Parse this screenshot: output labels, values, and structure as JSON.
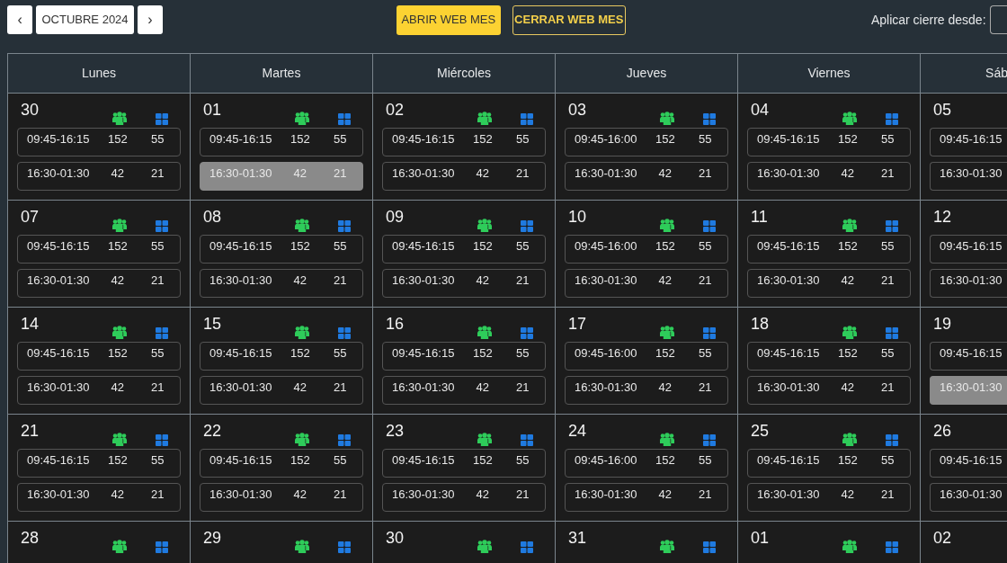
{
  "toolbar": {
    "prev": "‹",
    "month": "OCTUBRE 2024",
    "next": "›",
    "open_button": "ABRIR WEB MES",
    "close_button": "CERRAR WEB MES",
    "apply_label": "Aplicar cierre desde:"
  },
  "weekdays": [
    "Lunes",
    "Martes",
    "Miércoles",
    "Jueves",
    "Viernes",
    "Sáb"
  ],
  "weeks": [
    {
      "days": [
        {
          "day": "30",
          "slots": [
            {
              "time": "09:45-16:15",
              "col_a": "152",
              "col_b": "55",
              "selected": false
            },
            {
              "time": "16:30-01:30",
              "col_a": "42",
              "col_b": "21",
              "selected": false
            }
          ]
        },
        {
          "day": "01",
          "slots": [
            {
              "time": "09:45-16:15",
              "col_a": "152",
              "col_b": "55",
              "selected": false
            },
            {
              "time": "16:30-01:30",
              "col_a": "42",
              "col_b": "21",
              "selected": true
            }
          ]
        },
        {
          "day": "02",
          "slots": [
            {
              "time": "09:45-16:15",
              "col_a": "152",
              "col_b": "55",
              "selected": false
            },
            {
              "time": "16:30-01:30",
              "col_a": "42",
              "col_b": "21",
              "selected": false
            }
          ]
        },
        {
          "day": "03",
          "slots": [
            {
              "time": "09:45-16:00",
              "col_a": "152",
              "col_b": "55",
              "selected": false
            },
            {
              "time": "16:30-01:30",
              "col_a": "42",
              "col_b": "21",
              "selected": false
            }
          ]
        },
        {
          "day": "04",
          "slots": [
            {
              "time": "09:45-16:15",
              "col_a": "152",
              "col_b": "55",
              "selected": false
            },
            {
              "time": "16:30-01:30",
              "col_a": "42",
              "col_b": "21",
              "selected": false
            }
          ]
        },
        {
          "day": "05",
          "slots": [
            {
              "time": "09:45-16:15",
              "selected": false
            },
            {
              "time": "16:30-01:30",
              "selected": false
            }
          ]
        }
      ]
    },
    {
      "days": [
        {
          "day": "07",
          "slots": [
            {
              "time": "09:45-16:15",
              "col_a": "152",
              "col_b": "55",
              "selected": false
            },
            {
              "time": "16:30-01:30",
              "col_a": "42",
              "col_b": "21",
              "selected": false
            }
          ]
        },
        {
          "day": "08",
          "slots": [
            {
              "time": "09:45-16:15",
              "col_a": "152",
              "col_b": "55",
              "selected": false
            },
            {
              "time": "16:30-01:30",
              "col_a": "42",
              "col_b": "21",
              "selected": false
            }
          ]
        },
        {
          "day": "09",
          "slots": [
            {
              "time": "09:45-16:15",
              "col_a": "152",
              "col_b": "55",
              "selected": false
            },
            {
              "time": "16:30-01:30",
              "col_a": "42",
              "col_b": "21",
              "selected": false
            }
          ]
        },
        {
          "day": "10",
          "slots": [
            {
              "time": "09:45-16:00",
              "col_a": "152",
              "col_b": "55",
              "selected": false
            },
            {
              "time": "16:30-01:30",
              "col_a": "42",
              "col_b": "21",
              "selected": false
            }
          ]
        },
        {
          "day": "11",
          "slots": [
            {
              "time": "09:45-16:15",
              "col_a": "152",
              "col_b": "55",
              "selected": false
            },
            {
              "time": "16:30-01:30",
              "col_a": "42",
              "col_b": "21",
              "selected": false
            }
          ]
        },
        {
          "day": "12",
          "slots": [
            {
              "time": "09:45-16:15",
              "selected": false
            },
            {
              "time": "16:30-01:30",
              "selected": false
            }
          ]
        }
      ]
    },
    {
      "days": [
        {
          "day": "14",
          "slots": [
            {
              "time": "09:45-16:15",
              "col_a": "152",
              "col_b": "55",
              "selected": false
            },
            {
              "time": "16:30-01:30",
              "col_a": "42",
              "col_b": "21",
              "selected": false
            }
          ]
        },
        {
          "day": "15",
          "slots": [
            {
              "time": "09:45-16:15",
              "col_a": "152",
              "col_b": "55",
              "selected": false
            },
            {
              "time": "16:30-01:30",
              "col_a": "42",
              "col_b": "21",
              "selected": false
            }
          ]
        },
        {
          "day": "16",
          "slots": [
            {
              "time": "09:45-16:15",
              "col_a": "152",
              "col_b": "55",
              "selected": false
            },
            {
              "time": "16:30-01:30",
              "col_a": "42",
              "col_b": "21",
              "selected": false
            }
          ]
        },
        {
          "day": "17",
          "slots": [
            {
              "time": "09:45-16:00",
              "col_a": "152",
              "col_b": "55",
              "selected": false
            },
            {
              "time": "16:30-01:30",
              "col_a": "42",
              "col_b": "21",
              "selected": false
            }
          ]
        },
        {
          "day": "18",
          "slots": [
            {
              "time": "09:45-16:15",
              "col_a": "152",
              "col_b": "55",
              "selected": false
            },
            {
              "time": "16:30-01:30",
              "col_a": "42",
              "col_b": "21",
              "selected": false
            }
          ]
        },
        {
          "day": "19",
          "slots": [
            {
              "time": "09:45-16:15",
              "selected": false
            },
            {
              "time": "16:30-01:30",
              "selected": true
            }
          ]
        }
      ]
    },
    {
      "days": [
        {
          "day": "21",
          "slots": [
            {
              "time": "09:45-16:15",
              "col_a": "152",
              "col_b": "55",
              "selected": false
            },
            {
              "time": "16:30-01:30",
              "col_a": "42",
              "col_b": "21",
              "selected": false
            }
          ]
        },
        {
          "day": "22",
          "slots": [
            {
              "time": "09:45-16:15",
              "col_a": "152",
              "col_b": "55",
              "selected": false
            },
            {
              "time": "16:30-01:30",
              "col_a": "42",
              "col_b": "21",
              "selected": false
            }
          ]
        },
        {
          "day": "23",
          "slots": [
            {
              "time": "09:45-16:15",
              "col_a": "152",
              "col_b": "55",
              "selected": false
            },
            {
              "time": "16:30-01:30",
              "col_a": "42",
              "col_b": "21",
              "selected": false
            }
          ]
        },
        {
          "day": "24",
          "slots": [
            {
              "time": "09:45-16:00",
              "col_a": "152",
              "col_b": "55",
              "selected": false
            },
            {
              "time": "16:30-01:30",
              "col_a": "42",
              "col_b": "21",
              "selected": false
            }
          ]
        },
        {
          "day": "25",
          "slots": [
            {
              "time": "09:45-16:15",
              "col_a": "152",
              "col_b": "55",
              "selected": false
            },
            {
              "time": "16:30-01:30",
              "col_a": "42",
              "col_b": "21",
              "selected": false
            }
          ]
        },
        {
          "day": "26",
          "slots": [
            {
              "time": "09:45-16:15",
              "selected": false
            },
            {
              "time": "16:30-01:30",
              "selected": false
            }
          ]
        }
      ]
    },
    {
      "days": [
        {
          "day": "28"
        },
        {
          "day": "29"
        },
        {
          "day": "30"
        },
        {
          "day": "31"
        },
        {
          "day": "01"
        },
        {
          "day": "02"
        }
      ]
    }
  ]
}
